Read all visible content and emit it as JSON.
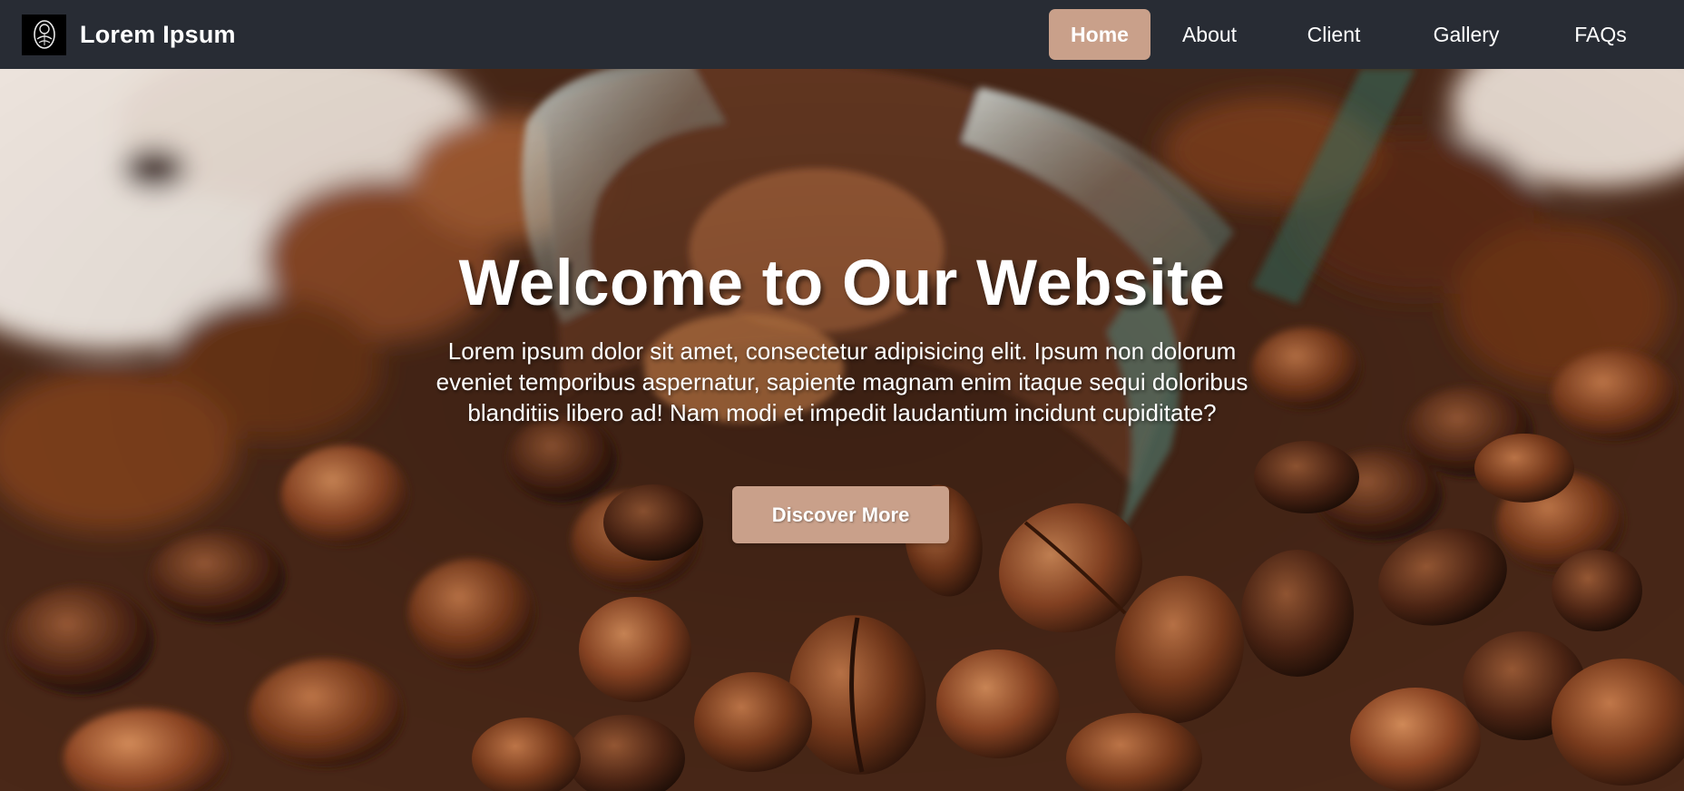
{
  "navbar": {
    "brand_title": "Lorem Ipsum",
    "logo_icon": "decorative-badge-icon",
    "background_color": "#282c34",
    "links": [
      {
        "label": "Home",
        "active": true
      },
      {
        "label": "About",
        "active": false
      },
      {
        "label": "Client",
        "active": false
      },
      {
        "label": "Gallery",
        "active": false
      },
      {
        "label": "FAQs",
        "active": false
      }
    ]
  },
  "hero": {
    "background_image": "coffee-beans-jar-photo",
    "title": "Welcome to Our Website",
    "text": "Lorem ipsum dolor sit amet, consectetur adipisicing elit. Ipsum non dolorum eveniet temporibus aspernatur, sapiente magnam enim itaque sequi doloribus blanditiis libero ad! Nam modi et impedit laudantium incidunt cupiditate?",
    "button_label": "Discover More"
  },
  "colors": {
    "accent": "#c9a08a",
    "nav_text": "#ffffff"
  }
}
